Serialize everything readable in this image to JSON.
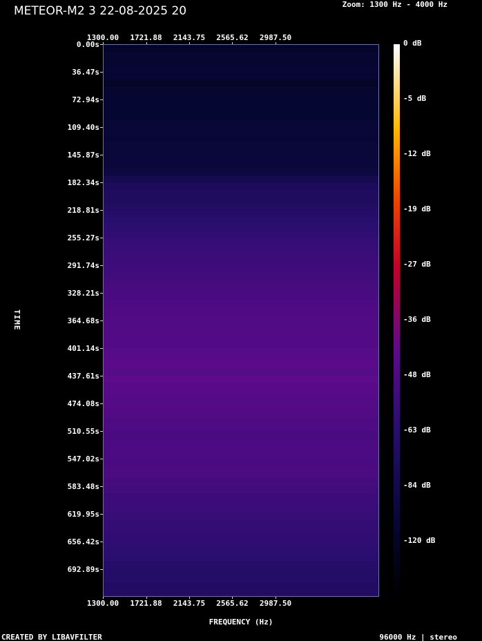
{
  "header": {
    "title": "METEOR-M2 3 22-08-2025 20",
    "zoom": "Zoom: 1300 Hz - 4000 Hz"
  },
  "chart_data": {
    "type": "heatmap",
    "x_tick_labels": [
      "1300.00",
      "1721.88",
      "2143.75",
      "2565.62",
      "2987.50"
    ],
    "y_tick_labels": [
      "0.00s",
      "36.47s",
      "72.94s",
      "109.40s",
      "145.87s",
      "182.34s",
      "218.81s",
      "255.27s",
      "291.74s",
      "328.21s",
      "364.68s",
      "401.14s",
      "437.61s",
      "474.08s",
      "510.55s",
      "547.02s",
      "583.48s",
      "619.95s",
      "656.42s",
      "692.89s"
    ],
    "xlabel": "FREQUENCY (Hz)",
    "ylabel": "TIME",
    "xlim": [
      1300,
      4000
    ],
    "ylim": [
      0,
      729.4
    ],
    "colorbar": {
      "labels": [
        "0 dB",
        "-5 dB",
        "-12 dB",
        "-19 dB",
        "-27 dB",
        "-36 dB",
        "-48 dB",
        "-63 dB",
        "-84 dB",
        "-120 dB"
      ]
    },
    "row_intensity_profile": [
      0.12,
      0.12,
      0.13,
      0.14,
      0.13,
      0.1,
      0.13,
      0.13,
      0.13,
      0.13,
      0.13,
      0.14,
      0.14,
      0.14,
      0.15,
      0.15,
      0.15,
      0.16,
      0.17,
      0.22,
      0.24,
      0.25,
      0.26,
      0.27,
      0.28,
      0.3,
      0.31,
      0.32,
      0.33,
      0.34,
      0.35,
      0.36,
      0.36,
      0.37,
      0.38,
      0.39,
      0.39,
      0.4,
      0.4,
      0.41,
      0.41,
      0.41,
      0.42,
      0.42,
      0.43,
      0.43,
      0.44,
      0.43,
      0.44,
      0.44,
      0.43,
      0.42,
      0.42,
      0.41,
      0.4,
      0.41,
      0.39,
      0.4,
      0.4,
      0.4,
      0.39,
      0.4,
      0.39,
      0.38,
      0.37,
      0.36,
      0.35,
      0.35,
      0.34,
      0.33,
      0.33,
      0.32,
      0.31,
      0.31,
      0.3,
      0.29,
      0.28,
      0.28,
      0.27,
      0.27
    ]
  },
  "footer": {
    "left": "CREATED BY LIBAVFILTER",
    "right": "96000 Hz | stereo"
  }
}
